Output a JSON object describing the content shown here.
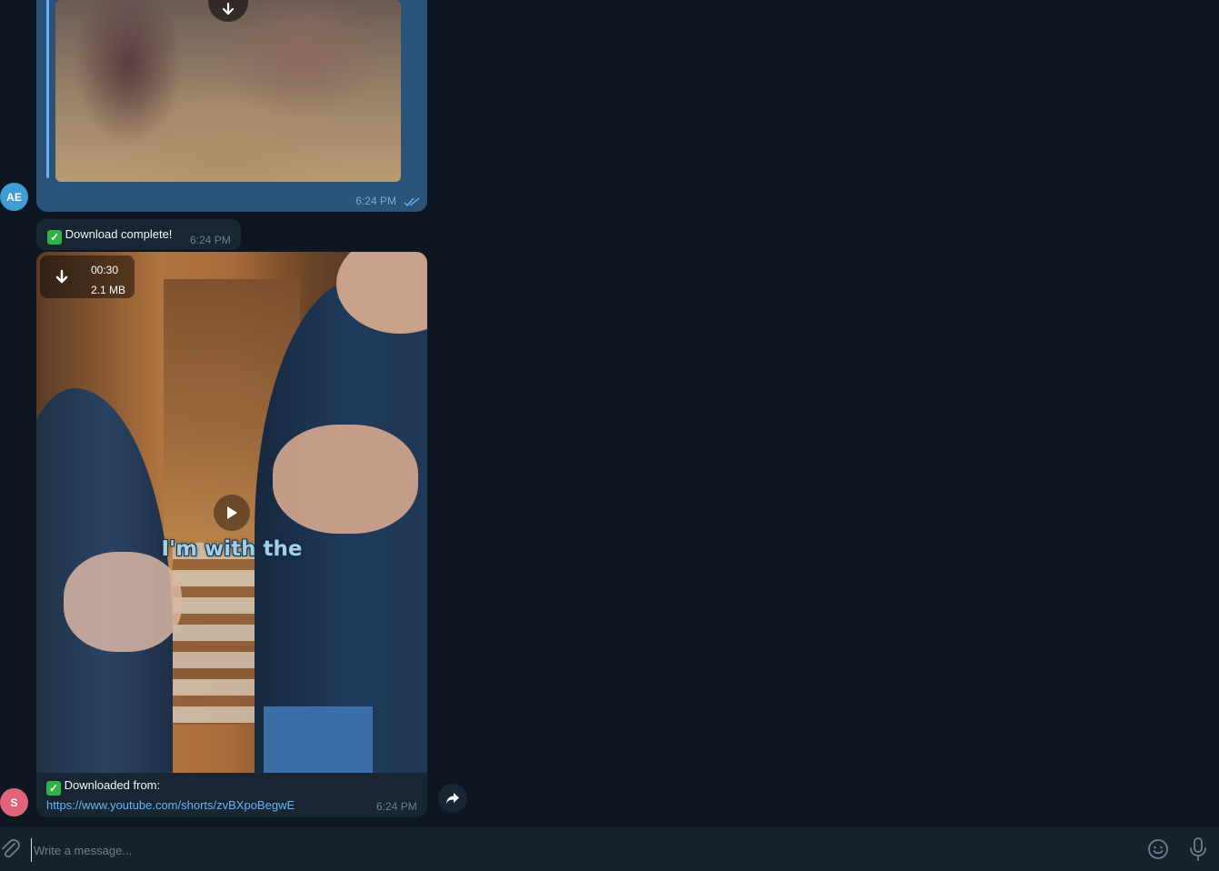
{
  "messages": {
    "forwarded_video": {
      "time": "6:24 PM",
      "status_icon": "double-check-icon"
    },
    "text_message": {
      "emoji": "✓",
      "text": "Download complete!",
      "time": "6:24 PM"
    },
    "video_message": {
      "duration": "00:30",
      "size": "2.1 MB",
      "subtitle": "I'm with the",
      "caption_emoji": "✓",
      "caption_line1": "Downloaded from:",
      "caption_link": "https://www.youtube.com/shorts/zvBXpoBegwE",
      "time": "6:24 PM"
    }
  },
  "avatars": {
    "top": "AE",
    "bottom": "S"
  },
  "composer": {
    "placeholder": "Write a message..."
  },
  "colors": {
    "background": "#0e1621",
    "outgoing_bubble": "#2b5278",
    "incoming_bubble": "#182533",
    "link": "#6ab3f3",
    "accent": "#2fb247"
  }
}
